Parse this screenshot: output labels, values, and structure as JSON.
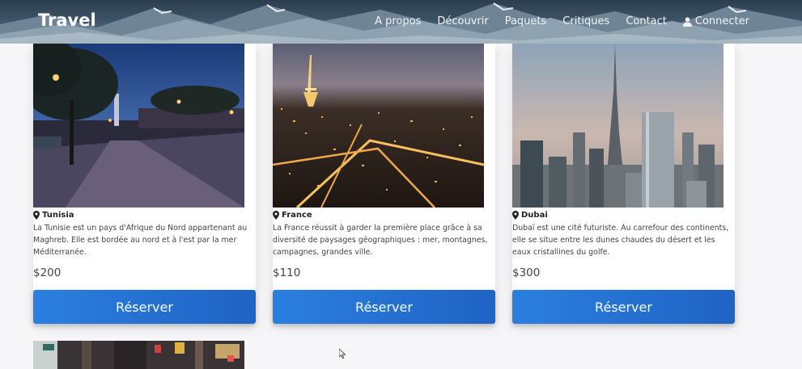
{
  "header": {
    "brand": "Travel",
    "nav": [
      {
        "label": "A propos"
      },
      {
        "label": "Découvrir"
      },
      {
        "label": "Paquets"
      },
      {
        "label": "Critiques"
      },
      {
        "label": "Contact"
      },
      {
        "label": "Connecter",
        "icon": "user-icon"
      }
    ]
  },
  "cards": [
    {
      "place": "Tunisia",
      "description": "La Tunisie est un pays d'Afrique du Nord appartenant au Maghreb. Elle est bordée au nord et à l'est par la mer Méditerranée.",
      "price": "$200",
      "button": "Réserver"
    },
    {
      "place": "France",
      "description": "La France réussit à garder la première place grâce à sa diversité de paysages géographiques : mer, montagnes, campagnes, grandes ville.",
      "price": "$110",
      "button": "Réserver"
    },
    {
      "place": "Dubai",
      "description": "Dubaï est une cité futuriste. Au carrefour des continents, elle se situe entre les dunes chaudes du désert et les eaux cristallines du golfe.",
      "price": "$300",
      "button": "Réserver"
    }
  ],
  "colors": {
    "button": "#2b7fe0",
    "header": "#3d5366"
  },
  "icons": [
    "map-pin-icon",
    "user-icon",
    "mouse-cursor-icon"
  ]
}
